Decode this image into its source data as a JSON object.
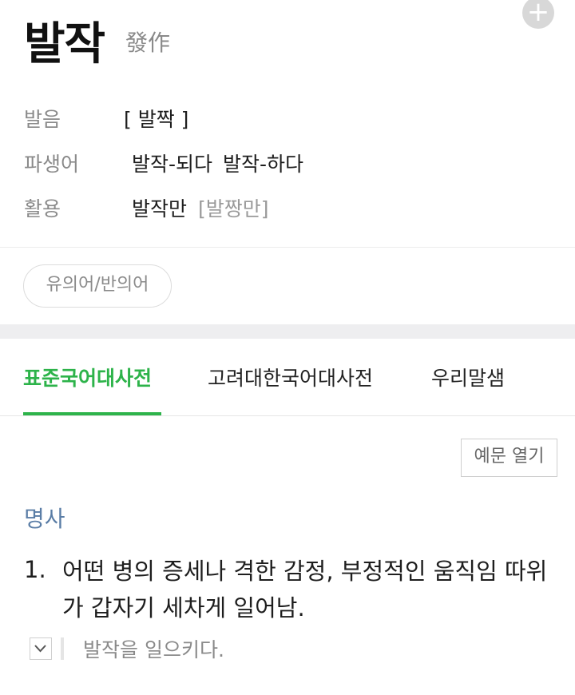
{
  "entry": {
    "word": "발작",
    "hanja": "發作",
    "add_icon": "plus-icon"
  },
  "info": {
    "pronunciation_label": "발음",
    "pronunciation_value": "[ 발짝 ]",
    "derivative_label": "파생어",
    "derivative_1": "발작-되다",
    "derivative_2": "발작-하다",
    "conjugation_label": "활용",
    "conjugation_value": "발작만",
    "conjugation_pron": "[발짱만]"
  },
  "chip": {
    "label": "유의어/반의어"
  },
  "tabs": [
    {
      "label": "표준국어대사전",
      "active": true
    },
    {
      "label": "고려대한국어대사전",
      "active": false
    },
    {
      "label": "우리말샘",
      "active": false
    }
  ],
  "content": {
    "example_button": "예문 열기",
    "part_of_speech": "명사",
    "definition_number": "1.",
    "definition_text": "어떤 병의 증세나 격한 감정, 부정적인 움직임 따위가 갑자기 세차게 일어남.",
    "example_text": "발작을 일으키다.",
    "toggle_icon": "chevron-down-icon"
  },
  "colors": {
    "accent_green": "#2db34a",
    "pos_blue": "#5a7da6",
    "label_gray": "#8a8a8a"
  }
}
